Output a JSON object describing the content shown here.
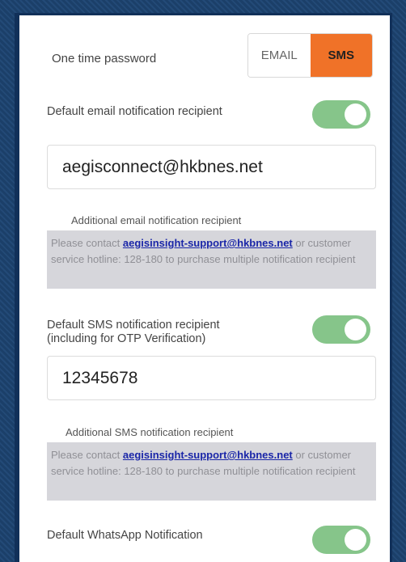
{
  "otp": {
    "label": "One time password",
    "options": [
      "EMAIL",
      "SMS"
    ],
    "selected": "SMS"
  },
  "email": {
    "default_label": "Default email notification recipient",
    "toggle_on": true,
    "value": "aegisconnect@hkbnes.net",
    "additional_label": "Additional email notification recipient",
    "note_prefix": "Please contact ",
    "note_link": "aegisinsight-support@hkbnes.net",
    "note_suffix": " or customer service hotline: 128-180 to purchase multiple notification recipient"
  },
  "sms": {
    "default_label_line1": "Default SMS notification recipient",
    "default_label_line2": "(including for OTP Verification)",
    "toggle_on": true,
    "value": "12345678",
    "additional_label": "Additional SMS notification recipient",
    "note_prefix": "Please contact ",
    "note_link": "aegisinsight-support@hkbnes.net",
    "note_suffix": " or customer service hotline: 128-180 to purchase multiple notification recipient"
  },
  "whatsapp": {
    "default_label": "Default WhatsApp Notification",
    "toggle_on": true
  },
  "colors": {
    "accent": "#f07228",
    "toggle": "#86c58a",
    "frame": "#113059",
    "link": "#1a26a8"
  }
}
